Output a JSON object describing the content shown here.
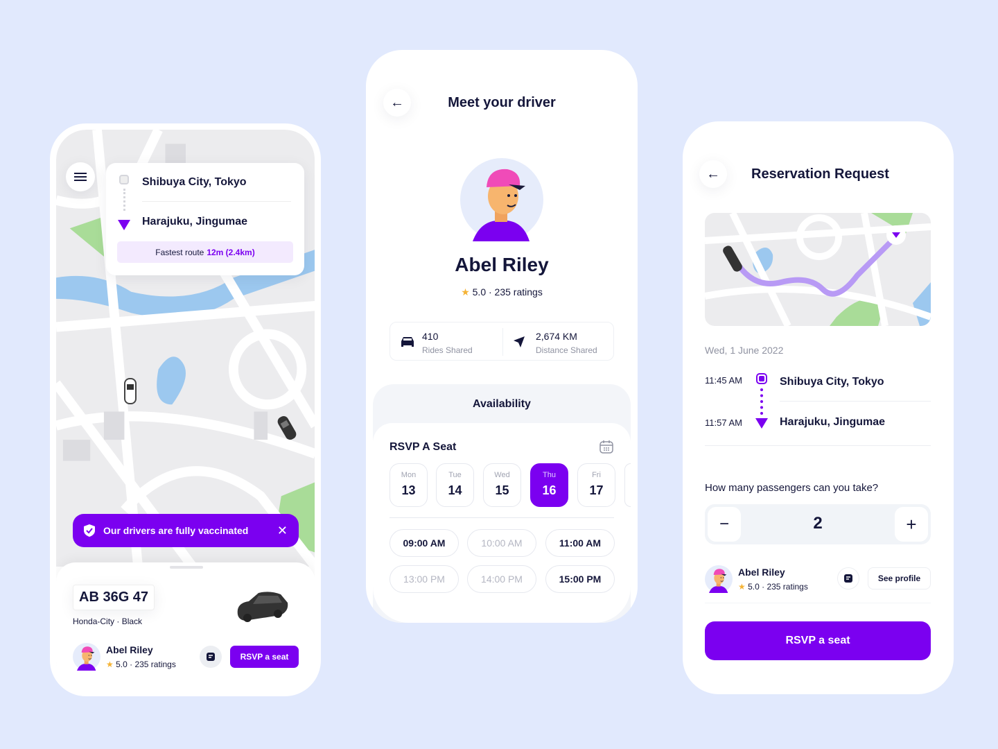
{
  "colors": {
    "accent": "#7b00f0",
    "background": "#e1e9fd",
    "text": "#14163a"
  },
  "screen1": {
    "menu_icon": "hamburger-icon",
    "origin": "Shibuya City, Tokyo",
    "destination": "Harajuku, Jingumae",
    "route_label": "Fastest route",
    "route_value": "12m (2.4km)",
    "banner": {
      "icon": "shield-check-icon",
      "text": "Our drivers are fully vaccinated",
      "close_icon": "close-icon"
    },
    "plate": "AB 36G 47",
    "car": "Honda-City · Black",
    "driver": {
      "name": "Abel Riley",
      "rating": "5.0 · 235 ratings"
    },
    "rsvp_label": "RSVP a seat"
  },
  "screen2": {
    "title": "Meet your driver",
    "driver_name": "Abel Riley",
    "rating": "5.0 · 235 ratings",
    "stats": [
      {
        "value": "410",
        "label": "Rides Shared",
        "icon": "car-icon"
      },
      {
        "value": "2,674 KM",
        "label": "Distance Shared",
        "icon": "navigation-icon"
      }
    ],
    "availability": "Availability",
    "rsvp_title": "RSVP A Seat",
    "days": [
      {
        "name": "Mon",
        "date": "13"
      },
      {
        "name": "Tue",
        "date": "14"
      },
      {
        "name": "Wed",
        "date": "15"
      },
      {
        "name": "Thu",
        "date": "16",
        "selected": true
      },
      {
        "name": "Fri",
        "date": "17"
      }
    ],
    "slots": [
      {
        "time": "09:00 AM",
        "available": true
      },
      {
        "time": "10:00 AM",
        "available": false
      },
      {
        "time": "11:00 AM",
        "available": true
      },
      {
        "time": "13:00 PM",
        "available": false
      },
      {
        "time": "14:00 PM",
        "available": false
      },
      {
        "time": "15:00 PM",
        "available": true
      }
    ]
  },
  "screen3": {
    "title": "Reservation Request",
    "date": "Wed, 1 June 2022",
    "stops": [
      {
        "time": "11:45 AM",
        "place": "Shibuya City, Tokyo"
      },
      {
        "time": "11:57 AM",
        "place": "Harajuku, Jingumae"
      }
    ],
    "question": "How many passengers can you take?",
    "passengers": "2",
    "driver": {
      "name": "Abel Riley",
      "rating": "5.0 · 235 ratings"
    },
    "see_profile": "See profile",
    "rsvp_label": "RSVP a seat"
  }
}
